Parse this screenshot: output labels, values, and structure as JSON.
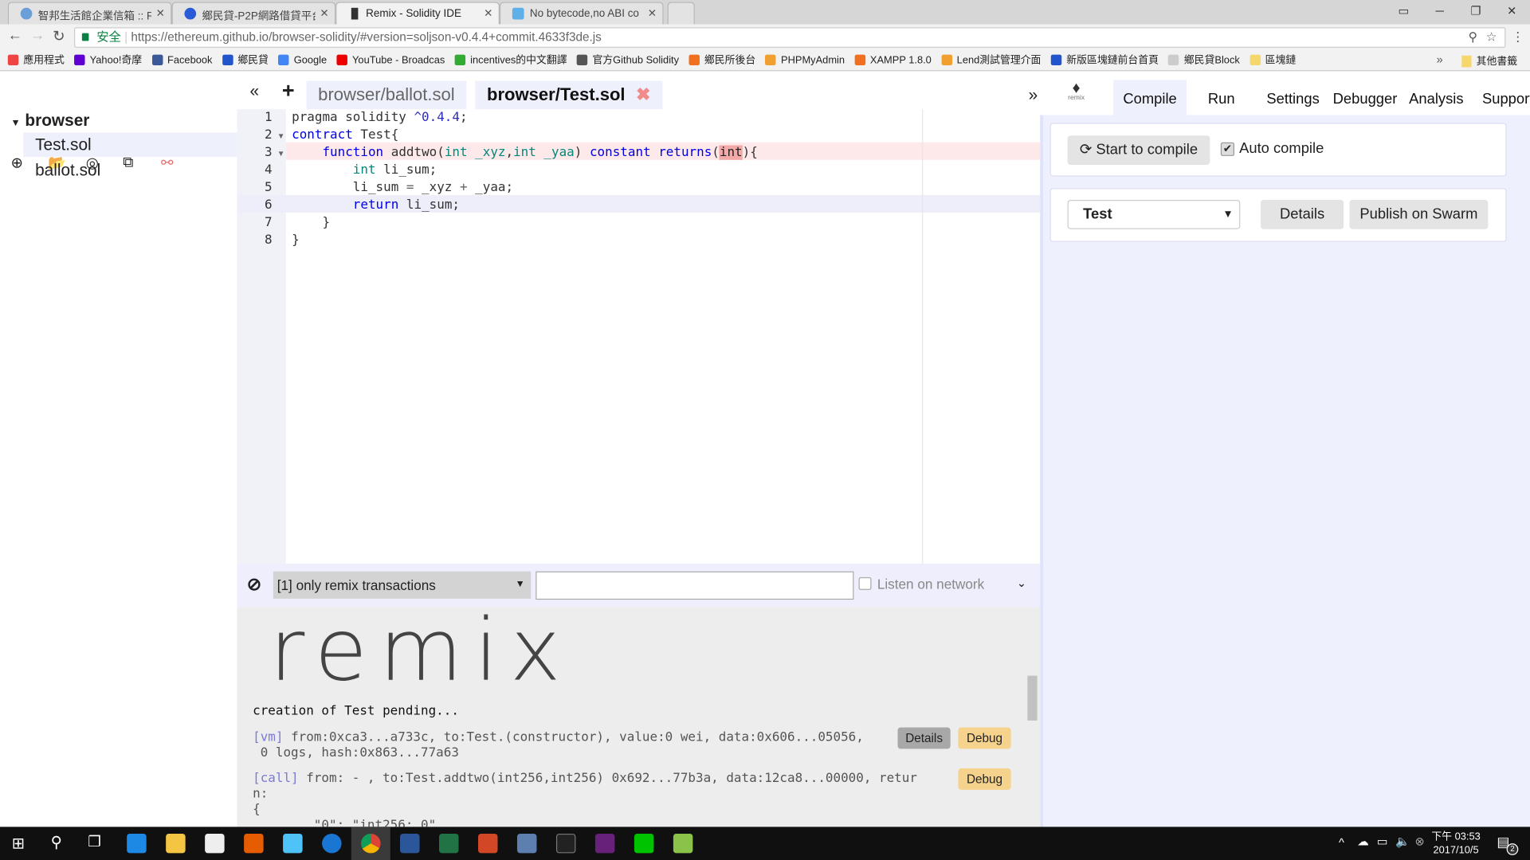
{
  "browser": {
    "tabs": [
      {
        "title": "智邦生活館企業信箱 :: Re",
        "active": false
      },
      {
        "title": "鄉民貸-P2P網路借貸平台",
        "active": false
      },
      {
        "title": "Remix - Solidity IDE",
        "active": true
      },
      {
        "title": "No bytecode,no ABI co",
        "active": false
      }
    ],
    "secure_label": "安全",
    "url": "https://ethereum.github.io/browser-solidity/#version=soljson-v0.4.4+commit.4633f3de.js",
    "bookmarks": [
      {
        "label": "應用程式",
        "color": "#e44"
      },
      {
        "label": "Yahoo!奇摩",
        "color": "#5f01d1"
      },
      {
        "label": "Facebook",
        "color": "#3b5998"
      },
      {
        "label": "鄉民貸",
        "color": "#2255cc"
      },
      {
        "label": "Google",
        "color": "#4285f4"
      },
      {
        "label": "YouTube - Broadcas",
        "color": "#e00"
      },
      {
        "label": "incentives的中文翻譯",
        "color": "#3a3"
      },
      {
        "label": "官方Github Solidity",
        "color": "#555"
      },
      {
        "label": "鄉民所後台",
        "color": "#f07020"
      },
      {
        "label": "PHPMyAdmin",
        "color": "#f0a030"
      },
      {
        "label": "XAMPP 1.8.0",
        "color": "#f07020"
      },
      {
        "label": "Lend測試管理介面",
        "color": "#f0a030"
      },
      {
        "label": "新版區塊鏈前台首頁",
        "color": "#2255cc"
      },
      {
        "label": "鄉民貸Block",
        "color": "#ccc"
      },
      {
        "label": "區塊鏈",
        "color": "#f5d76e"
      }
    ],
    "bookmarks_more": "»",
    "other_bookmarks": "其他書籤"
  },
  "files": {
    "root": "browser",
    "items": [
      "Test.sol",
      "ballot.sol"
    ],
    "selected": "Test.sol"
  },
  "editor": {
    "tabs": [
      {
        "label": "browser/ballot.sol",
        "active": false
      },
      {
        "label": "browser/Test.sol",
        "active": true
      }
    ],
    "close_glyph": "✖",
    "collapse_left": "«",
    "add": "+",
    "collapse_right": "»",
    "lines": [
      [
        [
          "nm",
          "pragma solidity "
        ],
        [
          "num",
          "^0.4.4"
        ],
        [
          "nm",
          ";"
        ]
      ],
      [
        [
          "kw",
          "contract"
        ],
        [
          "nm",
          " Test{"
        ]
      ],
      [
        [
          "nm",
          "    "
        ],
        [
          "kw",
          "function"
        ],
        [
          "nm",
          " addtwo("
        ],
        [
          "ty",
          "int _xyz"
        ],
        [
          "nm",
          ","
        ],
        [
          "ty",
          "int _yaa"
        ],
        [
          "nm",
          ") "
        ],
        [
          "kw",
          "constant returns"
        ],
        [
          "nm",
          "("
        ],
        [
          "mark",
          "int"
        ],
        [
          "nm",
          "){"
        ]
      ],
      [
        [
          "nm",
          "        "
        ],
        [
          "ty",
          "int"
        ],
        [
          "nm",
          " li_sum;"
        ]
      ],
      [
        [
          "nm",
          "        li_sum "
        ],
        [
          "op",
          "="
        ],
        [
          "nm",
          " _xyz "
        ],
        [
          "op",
          "+"
        ],
        [
          "nm",
          " _yaa;"
        ]
      ],
      [
        [
          "nm",
          "        "
        ],
        [
          "kw",
          "return"
        ],
        [
          "nm",
          " li_sum;"
        ]
      ],
      [
        [
          "nm",
          "    }"
        ]
      ],
      [
        [
          "nm",
          "}"
        ]
      ]
    ]
  },
  "console": {
    "filter": "[1] only remix transactions",
    "search_value": "",
    "listen_label": "Listen on network",
    "logo": "remix",
    "pending": "creation of Test pending...",
    "tx1_tag": "[vm]",
    "tx1_text": " from:0xca3...a733c, to:Test.(constructor), value:0 wei, data:0x606...05056,",
    "tx1_text2": " 0 logs, hash:0x863...77a63",
    "tx2_tag": "[call]",
    "tx2_text": " from: - , to:Test.addtwo(int256,int256) 0x692...77b3a, data:12ca8...00000, retur",
    "tx2_text2": "n:",
    "tx2_text3": "{",
    "tx2_text4": "        \"0\": \"int256: 0\"",
    "details_label": "Details",
    "debug_label": "Debug"
  },
  "right": {
    "logo_text": "remix",
    "tabs": [
      "Compile",
      "Run",
      "Settings",
      "Debugger",
      "Analysis",
      "Support"
    ],
    "active_tab": "Compile",
    "compile_button": "Start to compile",
    "auto_compile_label": "Auto compile",
    "auto_compile": true,
    "contract_select": "Test",
    "details_button": "Details",
    "publish_button": "Publish on Swarm"
  },
  "taskbar": {
    "time": "下午 03:53",
    "date": "2017/10/5",
    "notifications": "2"
  }
}
